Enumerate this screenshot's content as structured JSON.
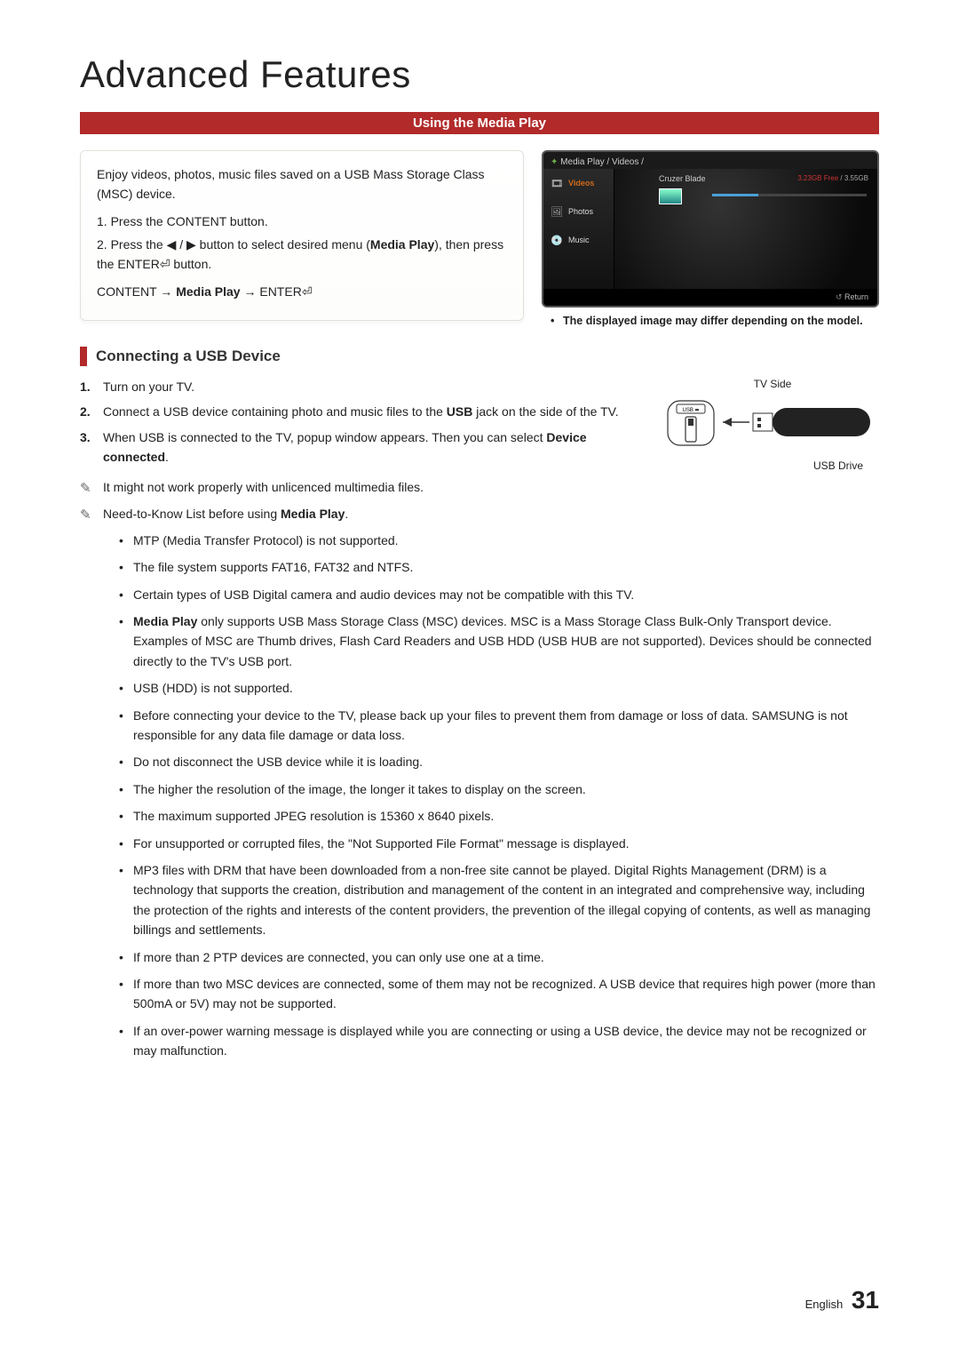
{
  "page_title": "Advanced Features",
  "section_bar": "Using the Media Play",
  "intro": {
    "para": "Enjoy videos, photos, music files saved on a USB Mass Storage Class (MSC) device.",
    "step1_pre": "1. Press the ",
    "step1_btn": "CONTENT",
    "step1_post": " button.",
    "step2_pre": "2. Press the ",
    "step2_arrows": "◀ / ▶",
    "step2_mid": " button to select desired menu (",
    "step2_media": "Media Play",
    "step2_mid2": "), then press the ",
    "step2_enter": "ENTER",
    "step2_glyph": "⏎",
    "step2_post": " button.",
    "path_content": "CONTENT",
    "path_arrow1": " → ",
    "path_media": "Media Play",
    "path_arrow2": " → ",
    "path_enter": "ENTER",
    "path_glyph": "⏎"
  },
  "tv": {
    "breadcrumb": "Media Play / Videos /",
    "device": "Cruzer Blade",
    "storage_free": "3.23GB Free",
    "storage_sep": " / ",
    "storage_total": "3.55GB",
    "nav_videos": "Videos",
    "nav_photos": "Photos",
    "nav_music": "Music",
    "return": "Return",
    "caption": "The displayed image may differ depending on the model."
  },
  "usb_section": "Connecting a USB Device",
  "usb_steps": {
    "n1": "1.",
    "s1": "Turn on your TV.",
    "n2": "2.",
    "s2_pre": "Connect a USB device containing photo and music files to the ",
    "s2_usb": "USB",
    "s2_post": " jack on the side of the TV.",
    "n3": "3.",
    "s3_pre": "When USB is connected to the TV, popup window appears. Then you can select ",
    "s3_bold": "Device connected",
    "s3_post": "."
  },
  "usb_diagram": {
    "tv_side": "TV Side",
    "usb_port": "USB",
    "usb_drive": "USB Drive"
  },
  "notes": {
    "n1": "It might not work properly with unlicenced multimedia files.",
    "n2_pre": "Need-to-Know List before using ",
    "n2_bold": "Media Play",
    "n2_post": "."
  },
  "bullets": [
    "MTP (Media Transfer Protocol) is not supported.",
    "The file system supports FAT16, FAT32 and NTFS.",
    "Certain types of USB Digital camera and audio devices may not be compatible with this TV.",
    "__MP__Media Play__/MP__ only supports USB Mass Storage Class (MSC) devices. MSC is a Mass Storage Class Bulk-Only Transport device. Examples of MSC are Thumb drives, Flash Card Readers and USB HDD (USB HUB are not supported). Devices should be connected directly to the TV's USB port.",
    "USB (HDD) is not supported.",
    "Before connecting your device to the TV, please back up your files to prevent them from damage or loss of data. SAMSUNG is not responsible for any data file damage or data loss.",
    "Do not disconnect the USB device while it is loading.",
    "The higher the resolution of the image, the longer it takes to display on the screen.",
    "The maximum supported JPEG resolution is 15360 x 8640 pixels.",
    "For unsupported or corrupted files, the \"Not Supported File Format\" message is displayed.",
    "MP3 files with DRM that have been downloaded from a non-free site cannot be played. Digital Rights Management (DRM) is a technology that supports the creation, distribution and management of the content in an integrated and comprehensive way, including the protection of the rights and interests of the content providers, the prevention of the illegal copying of contents, as well as managing billings and settlements.",
    "If more than 2 PTP devices are connected, you can only use one at a time.",
    "If more than two MSC devices are connected, some of them may not be recognized. A USB device that requires high power (more than 500mA or 5V) may not be supported.",
    "If an over-power warning message is displayed while you are connecting or using a USB device, the device may not be recognized or may malfunction."
  ],
  "footer": {
    "lang": "English",
    "page": "31"
  }
}
